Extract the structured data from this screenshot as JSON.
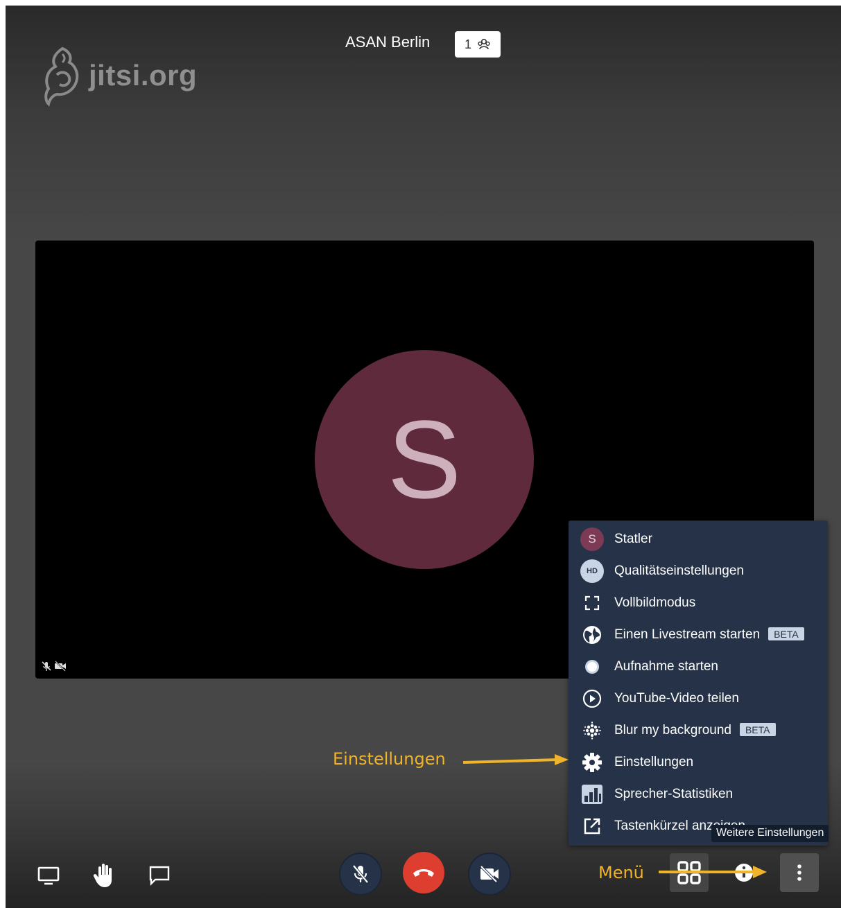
{
  "logo": {
    "text": "jitsi.org"
  },
  "header": {
    "room_name": "ASAN Berlin",
    "participant_count": "1"
  },
  "participant": {
    "initial": "S"
  },
  "menu": {
    "items": [
      {
        "label": "Statler",
        "icon": "avatar-s-icon",
        "avatar_initial": "S"
      },
      {
        "label": "Qualitätseinstellungen",
        "icon": "hd-icon",
        "icon_text": "HD"
      },
      {
        "label": "Vollbildmodus",
        "icon": "fullscreen-icon"
      },
      {
        "label": "Einen Livestream starten",
        "icon": "globe-icon",
        "badge": "BETA"
      },
      {
        "label": "Aufnahme starten",
        "icon": "record-icon"
      },
      {
        "label": "YouTube-Video teilen",
        "icon": "play-icon"
      },
      {
        "label": "Blur my background",
        "icon": "blur-icon",
        "badge": "BETA"
      },
      {
        "label": "Einstellungen",
        "icon": "gear-icon"
      },
      {
        "label": "Sprecher-Statistiken",
        "icon": "bar-chart-icon"
      },
      {
        "label": "Tastenkürzel anzeigen",
        "icon": "external-link-icon"
      }
    ]
  },
  "tooltip": {
    "text": "Weitere Einstellungen"
  },
  "annotations": {
    "settings": "Einstellungen",
    "menu": "Menü"
  },
  "colors": {
    "annotation": "#f0b42a",
    "menu_bg": "#253247",
    "hangup": "#dd3e30",
    "avatar": "#5e2a3c"
  }
}
